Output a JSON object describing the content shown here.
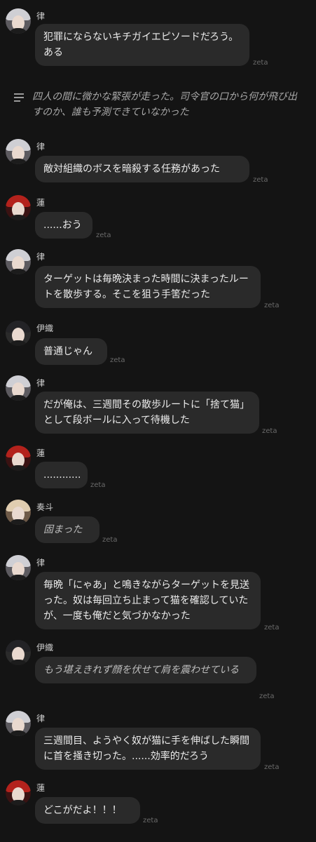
{
  "brand_tag": "zeta",
  "colors": {
    "background": "#141414",
    "bubble": "#2a2a2a",
    "text": "#ececec",
    "narration_text": "#a9a9a9",
    "tag": "#6a6a6a"
  },
  "narration": {
    "icon": "menu-lines-icon",
    "text": "四人の間に微かな緊張が走った。司令官の口から何が飛び出すのか、誰も予測できていなかった"
  },
  "messages": [
    {
      "speaker": "律",
      "avatar": "ritsu",
      "text": "犯罪にならないキチガイエピソードだろう。ある",
      "style": "speech"
    },
    {
      "speaker": "律",
      "avatar": "ritsu",
      "text": "敵対組織のボスを暗殺する任務があった",
      "style": "speech"
    },
    {
      "speaker": "蓮",
      "avatar": "ren",
      "text": "......おう",
      "style": "speech"
    },
    {
      "speaker": "律",
      "avatar": "ritsu",
      "text": "ターゲットは毎晩決まった時間に決まったルートを散歩する。そこを狙う手筈だった",
      "style": "speech"
    },
    {
      "speaker": "伊織",
      "avatar": "iori",
      "text": "普通じゃん",
      "style": "speech"
    },
    {
      "speaker": "律",
      "avatar": "ritsu",
      "text": "だが俺は、三週間その散歩ルートに「捨て猫」として段ボールに入って待機した",
      "style": "speech"
    },
    {
      "speaker": "蓮",
      "avatar": "ren",
      "text": "............",
      "style": "speech"
    },
    {
      "speaker": "奏斗",
      "avatar": "kanato",
      "text": "固まった",
      "style": "action"
    },
    {
      "speaker": "律",
      "avatar": "ritsu",
      "text": "毎晩「にゃあ」と鳴きながらターゲットを見送った。奴は毎回立ち止まって猫を確認していたが、一度も俺だと気づかなかった",
      "style": "speech"
    },
    {
      "speaker": "伊織",
      "avatar": "iori",
      "text": "もう堪えきれず顔を伏せて肩を震わせている",
      "style": "action"
    },
    {
      "speaker": "律",
      "avatar": "ritsu",
      "text": "三週間目、ようやく奴が猫に手を伸ばした瞬間に首を掻き切った。......効率的だろう",
      "style": "speech"
    },
    {
      "speaker": "蓮",
      "avatar": "ren",
      "text": "どこがだよ！！！",
      "style": "speech"
    }
  ]
}
